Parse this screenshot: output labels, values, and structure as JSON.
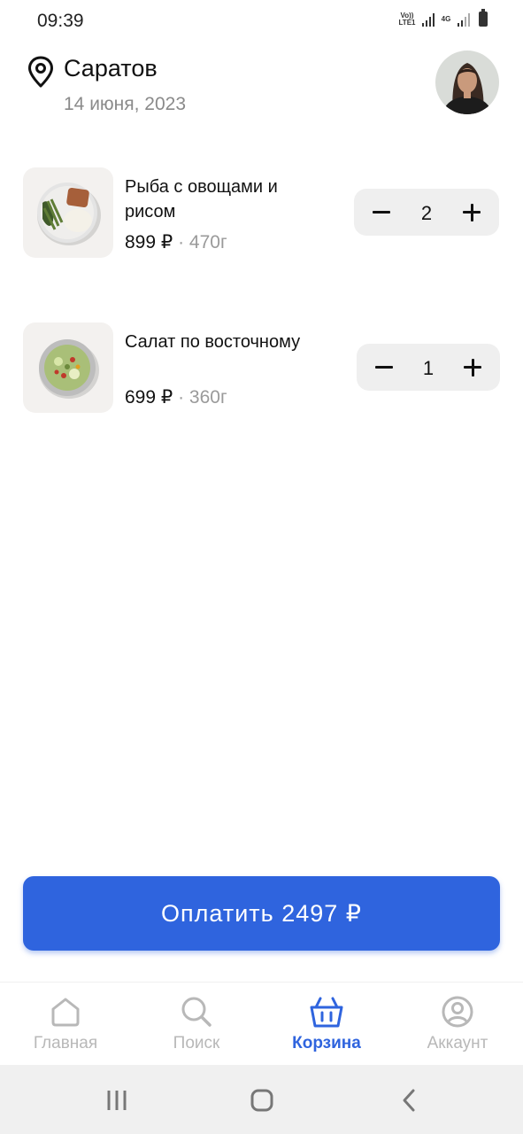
{
  "status_bar": {
    "time": "09:39",
    "volte_label": "Vo)) LTE1",
    "network_label": "4G"
  },
  "header": {
    "city": "Саратов",
    "date": "14 июня, 2023"
  },
  "cart": {
    "items": [
      {
        "name": "Рыба с овощами и рисом",
        "price": "899 ₽",
        "separator": "·",
        "weight": "470г",
        "quantity": "2"
      },
      {
        "name": "Салат по восточному",
        "price": "699 ₽",
        "separator": "·",
        "weight": "360г",
        "quantity": "1"
      }
    ]
  },
  "pay_button": {
    "label": "Оплатить 2497 ₽"
  },
  "tabs": [
    {
      "label": "Главная",
      "icon": "home-icon"
    },
    {
      "label": "Поиск",
      "icon": "search-icon"
    },
    {
      "label": "Корзина",
      "icon": "basket-icon",
      "active": true
    },
    {
      "label": "Аккаунт",
      "icon": "account-icon"
    }
  ],
  "colors": {
    "accent": "#2f64de",
    "inactive_tab": "#b8b8b8",
    "muted_text": "#8a8a8a"
  }
}
